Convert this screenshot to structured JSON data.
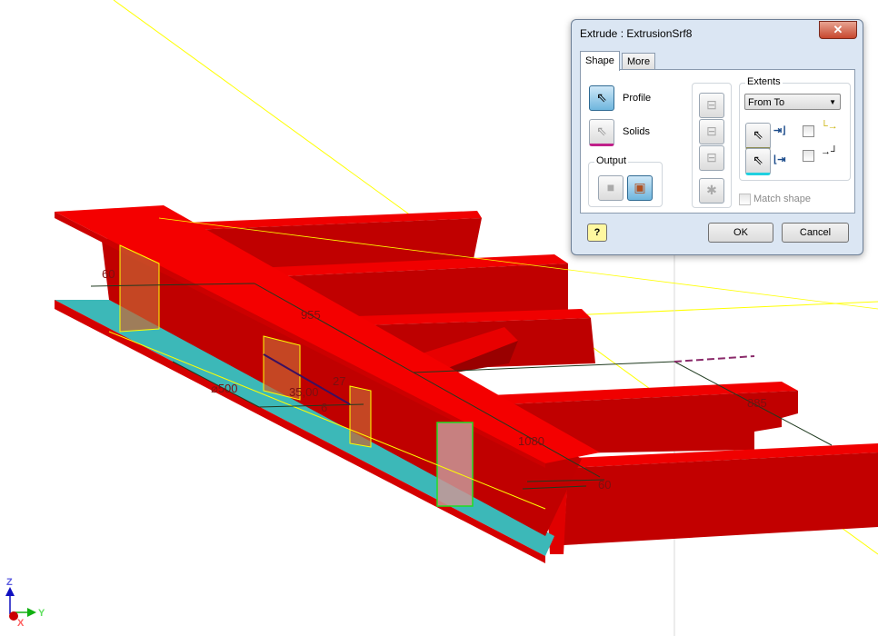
{
  "viewport": {
    "dimensions": [
      "955",
      "35,00",
      "27",
      "6",
      "⌀500",
      "60",
      "1080",
      "885",
      "60"
    ],
    "triad": {
      "z": "Z",
      "y": "Y",
      "x": "X"
    },
    "colors": {
      "part": "#e00000",
      "part_dark": "#b80000",
      "face_selected": "#3cb8b8",
      "sketch": "#ffff00",
      "preview": "#c86432"
    }
  },
  "dialog": {
    "title": "Extrude : ExtrusionSrf8",
    "close_icon": "close-icon",
    "tabs": [
      {
        "label": "Shape",
        "active": true
      },
      {
        "label": "More",
        "active": false
      }
    ],
    "profile_label": "Profile",
    "solids_label": "Solids",
    "output_label": "Output",
    "extents_label": "Extents",
    "extents_value": "From To",
    "match_shape_label": "Match shape",
    "match_shape_checked": false,
    "ok_label": "OK",
    "cancel_label": "Cancel",
    "help_icon": "help-icon"
  }
}
